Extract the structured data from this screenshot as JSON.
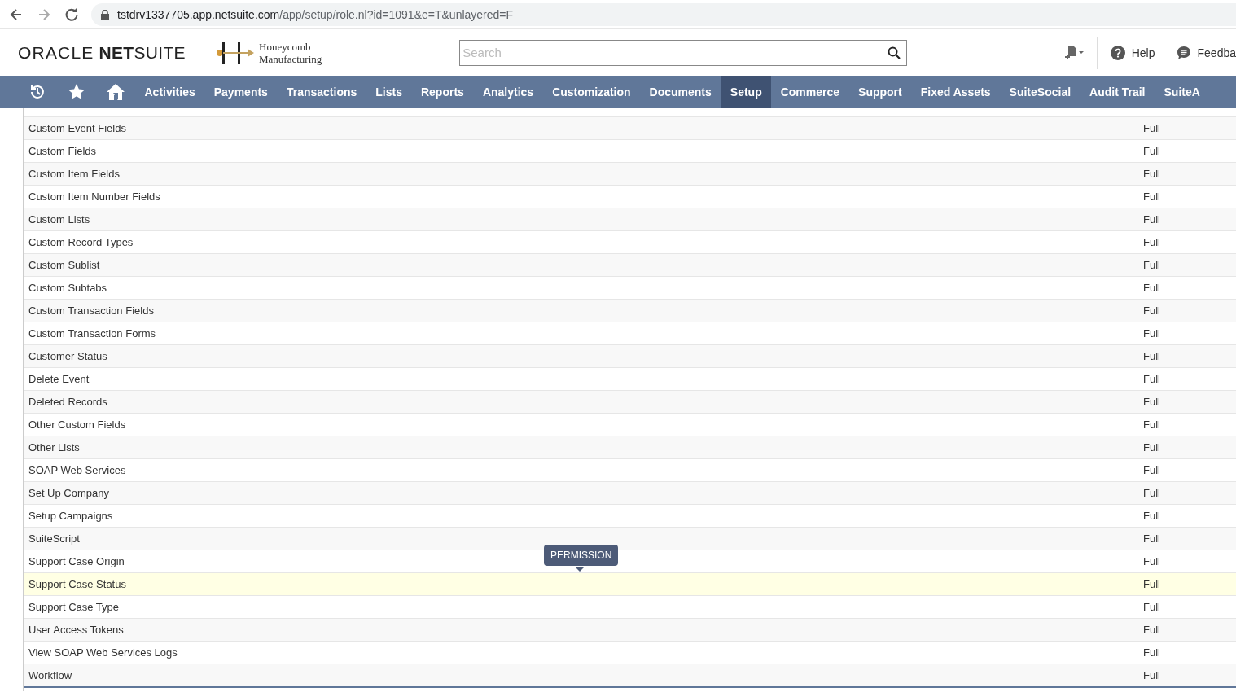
{
  "browser": {
    "url_host": "tstdrv1337705.app.netsuite.com",
    "url_path": "/app/setup/role.nl?id=1091&e=T&unlayered=F"
  },
  "header": {
    "brand": "ORACLE",
    "brand_bold": "NET",
    "brand_light": "SUITE",
    "company_line_1": "Honeycomb",
    "company_line_2": "Manufacturing",
    "search": {
      "placeholder": "Search"
    },
    "help": "Help",
    "feedback": "Feedba"
  },
  "nav": [
    {
      "label": "Activities",
      "selected": false
    },
    {
      "label": "Payments",
      "selected": false
    },
    {
      "label": "Transactions",
      "selected": false
    },
    {
      "label": "Lists",
      "selected": false
    },
    {
      "label": "Reports",
      "selected": false
    },
    {
      "label": "Analytics",
      "selected": false
    },
    {
      "label": "Customization",
      "selected": false
    },
    {
      "label": "Documents",
      "selected": false
    },
    {
      "label": "Setup",
      "selected": true
    },
    {
      "label": "Commerce",
      "selected": false
    },
    {
      "label": "Support",
      "selected": false
    },
    {
      "label": "Fixed Assets",
      "selected": false
    },
    {
      "label": "SuiteSocial",
      "selected": false
    },
    {
      "label": "Audit Trail",
      "selected": false
    },
    {
      "label": "SuiteA",
      "selected": false
    }
  ],
  "rows": [
    {
      "permission": "Custom Event Fields",
      "level": "Full",
      "highlighted": false
    },
    {
      "permission": "Custom Fields",
      "level": "Full",
      "highlighted": false
    },
    {
      "permission": "Custom Item Fields",
      "level": "Full",
      "highlighted": false
    },
    {
      "permission": "Custom Item Number Fields",
      "level": "Full",
      "highlighted": false
    },
    {
      "permission": "Custom Lists",
      "level": "Full",
      "highlighted": false
    },
    {
      "permission": "Custom Record Types",
      "level": "Full",
      "highlighted": false
    },
    {
      "permission": "Custom Sublist",
      "level": "Full",
      "highlighted": false
    },
    {
      "permission": "Custom Subtabs",
      "level": "Full",
      "highlighted": false
    },
    {
      "permission": "Custom Transaction Fields",
      "level": "Full",
      "highlighted": false
    },
    {
      "permission": "Custom Transaction Forms",
      "level": "Full",
      "highlighted": false
    },
    {
      "permission": "Customer Status",
      "level": "Full",
      "highlighted": false
    },
    {
      "permission": "Delete Event",
      "level": "Full",
      "highlighted": false
    },
    {
      "permission": "Deleted Records",
      "level": "Full",
      "highlighted": false
    },
    {
      "permission": "Other Custom Fields",
      "level": "Full",
      "highlighted": false
    },
    {
      "permission": "Other Lists",
      "level": "Full",
      "highlighted": false
    },
    {
      "permission": "SOAP Web Services",
      "level": "Full",
      "highlighted": false
    },
    {
      "permission": "Set Up Company",
      "level": "Full",
      "highlighted": false
    },
    {
      "permission": "Setup Campaigns",
      "level": "Full",
      "highlighted": false
    },
    {
      "permission": "SuiteScript",
      "level": "Full",
      "highlighted": false
    },
    {
      "permission": "Support Case Origin",
      "level": "Full",
      "highlighted": false
    },
    {
      "permission": "Support Case Status",
      "level": "Full",
      "highlighted": true
    },
    {
      "permission": "Support Case Type",
      "level": "Full",
      "highlighted": false
    },
    {
      "permission": "User Access Tokens",
      "level": "Full",
      "highlighted": false
    },
    {
      "permission": "View SOAP Web Services Logs",
      "level": "Full",
      "highlighted": false
    },
    {
      "permission": "Workflow",
      "level": "Full",
      "highlighted": false
    }
  ],
  "tooltip": "PERMISSION"
}
